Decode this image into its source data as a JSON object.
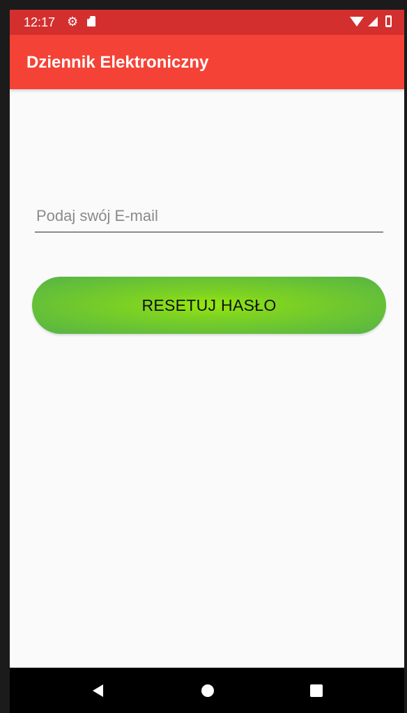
{
  "status_bar": {
    "time": "12:17",
    "icons": [
      "gear-icon",
      "sd-card-icon",
      "wifi-icon",
      "signal-icon",
      "battery-icon"
    ]
  },
  "app_bar": {
    "title": "Dziennik Elektroniczny",
    "color": "#f44336"
  },
  "form": {
    "email": {
      "value": "",
      "placeholder": "Podaj swój E-mail"
    },
    "reset_button": {
      "label": "RESETUJ HASŁO",
      "color": "#7ed321"
    }
  },
  "nav_bar": {
    "icons": [
      "back-icon",
      "home-icon",
      "recents-icon"
    ]
  }
}
